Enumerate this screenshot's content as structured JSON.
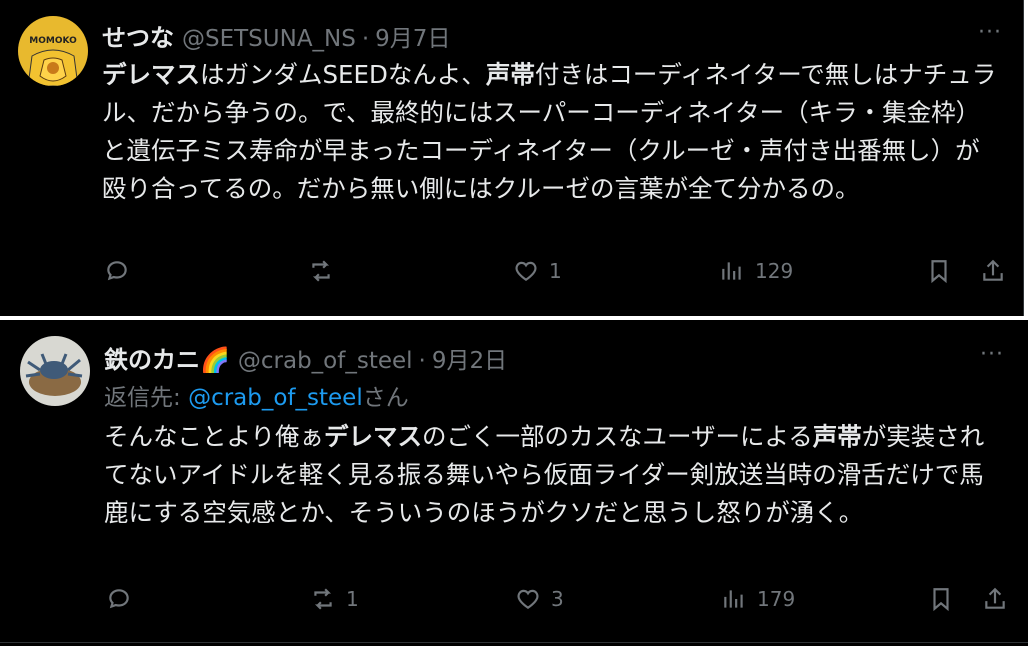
{
  "tweets": [
    {
      "display_name": "せつな",
      "handle": "@SETSUNA_NS",
      "separator": "·",
      "date": "9月7日",
      "more": "···",
      "avatar_text": "MOMOKO",
      "body_segments": [
        {
          "text": "デレマス",
          "bold": true
        },
        {
          "text": "はガンダムSEEDなんよ、",
          "bold": false
        },
        {
          "text": "声帯",
          "bold": true
        },
        {
          "text": "付きはコーディネイターで無しはナチュラル、だから争うの。で、最終的にはスーパーコーディネイター（キラ・集金枠）と遺伝子ミス寿命が早まったコーディネイター（クルーゼ・声付き出番無し）が殴り合ってるの。だから無い側にはクルーゼの言葉が全て分かるの。",
          "bold": false
        }
      ],
      "stats": {
        "replies": "",
        "reposts": "",
        "likes": "1",
        "views": "129"
      }
    },
    {
      "display_name": "鉄のカニ🌈",
      "handle": "@crab_of_steel",
      "separator": "·",
      "date": "9月2日",
      "more": "···",
      "reply_prefix": "返信先: ",
      "reply_handle": "@crab_of_steel",
      "reply_suffix": "さん",
      "body_segments": [
        {
          "text": "そんなことより俺ぁ",
          "bold": false
        },
        {
          "text": "デレマス",
          "bold": true
        },
        {
          "text": "のごく一部のカスなユーザーによる",
          "bold": false
        },
        {
          "text": "声帯",
          "bold": true
        },
        {
          "text": "が実装されてないアイドルを軽く見る振る舞いやら仮面ライダー剣放送当時の滑舌だけで馬鹿にする空気感とか、そういうのほうがクソだと思うし怒りが湧く。",
          "bold": false
        }
      ],
      "stats": {
        "replies": "",
        "reposts": "1",
        "likes": "3",
        "views": "179"
      }
    }
  ],
  "icons": [
    "reply-icon",
    "repost-icon",
    "like-icon",
    "views-icon",
    "bookmark-icon",
    "share-icon"
  ]
}
